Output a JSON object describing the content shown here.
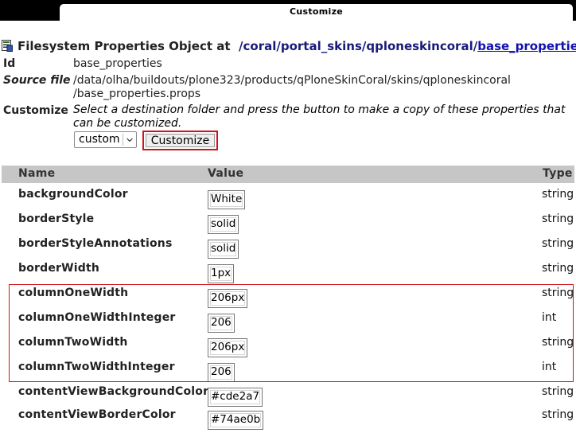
{
  "tab": {
    "title": "Customize"
  },
  "heading": {
    "prefix": "Filesystem Properties Object at",
    "breadcrumbs": [
      {
        "label": "/coral"
      },
      {
        "label": "portal_skins"
      },
      {
        "label": "qploneskincoral"
      },
      {
        "label": "base_properties"
      }
    ],
    "separator": "/"
  },
  "info": {
    "id_label": "Id",
    "id_value": "base_properties",
    "source_label": "Source file",
    "source_line1": "/data/olha/buildouts/plone323/products/qPloneSkinCoral/skins/qploneskincoral",
    "source_line2": "/base_properties.props",
    "customize_label": "Customize",
    "customize_desc": "Select a destination folder and press the button to make a copy of these properties that can be customized.",
    "folder_selected": "custom",
    "customize_button": "Customize"
  },
  "table": {
    "headers": {
      "name": "Name",
      "value": "Value",
      "type": "Type"
    },
    "rows": [
      {
        "name": "backgroundColor",
        "value": "White",
        "type": "string"
      },
      {
        "name": "borderStyle",
        "value": "solid",
        "type": "string"
      },
      {
        "name": "borderStyleAnnotations",
        "value": "solid",
        "type": "string"
      },
      {
        "name": "borderWidth",
        "value": "1px",
        "type": "string"
      },
      {
        "name": "columnOneWidth",
        "value": "206px",
        "type": "string"
      },
      {
        "name": "columnOneWidthInteger",
        "value": "206",
        "type": "int"
      },
      {
        "name": "columnTwoWidth",
        "value": "206px",
        "type": "string"
      },
      {
        "name": "columnTwoWidthInteger",
        "value": "206",
        "type": "int"
      },
      {
        "name": "contentViewBackgroundColor",
        "value": "#cde2a7",
        "type": "string"
      },
      {
        "name": "contentViewBorderColor",
        "value": "#74ae0b",
        "type": "string"
      }
    ]
  },
  "colors": {
    "highlight": "#d0121b",
    "header_bg": "#c6c6c6",
    "link": "#1a1a7a"
  }
}
